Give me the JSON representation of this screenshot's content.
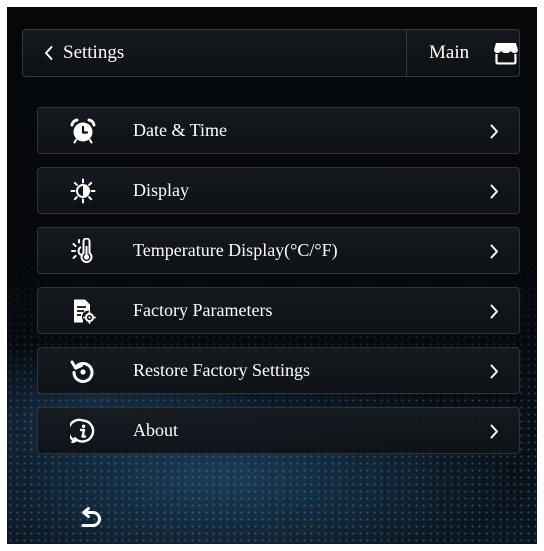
{
  "header": {
    "title": "Settings",
    "main_label": "Main"
  },
  "menu": {
    "items": [
      {
        "label": "Date & Time",
        "icon": "alarm-clock-icon"
      },
      {
        "label": "Display",
        "icon": "brightness-icon"
      },
      {
        "label": "Temperature Display(°C/°F)",
        "icon": "thermometer-icon"
      },
      {
        "label": "Factory Parameters",
        "icon": "document-gear-icon"
      },
      {
        "label": "Restore Factory Settings",
        "icon": "restore-icon"
      },
      {
        "label": "About",
        "icon": "info-icon"
      }
    ]
  },
  "footer": {
    "icon": "return-arrow-icon"
  },
  "colors": {
    "text": "#ffffff",
    "border": "#2e353c",
    "panel": "#12161a"
  }
}
